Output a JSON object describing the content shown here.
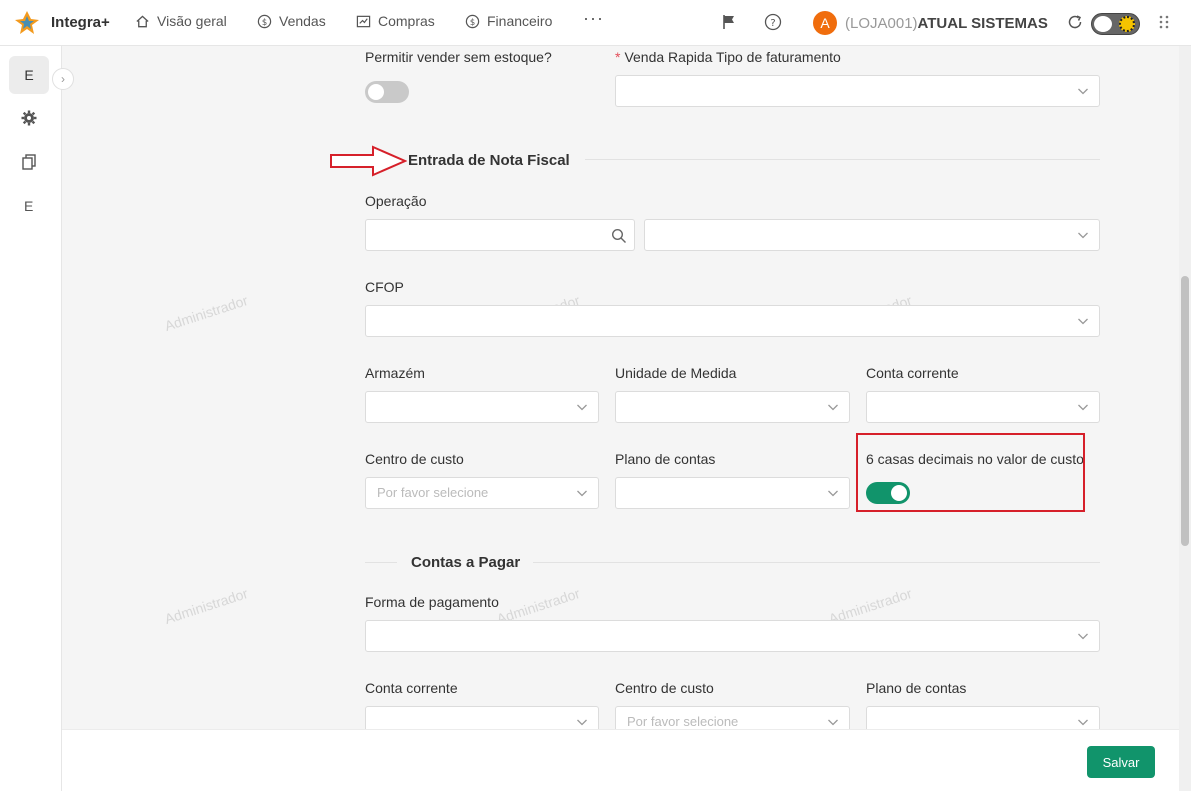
{
  "app": {
    "brand": "Integra+"
  },
  "nav": [
    {
      "label": "Visão geral",
      "icon": "home-icon"
    },
    {
      "label": "Vendas",
      "icon": "dollar-icon"
    },
    {
      "label": "Compras",
      "icon": "chart-icon"
    },
    {
      "label": "Financeiro",
      "icon": "dollar-icon"
    }
  ],
  "nav_more": "···",
  "user": {
    "avatar_letter": "A",
    "store_code": "(LOJA001)",
    "store_name": "ATUAL SISTEMAS"
  },
  "sidebar": {
    "item1": "E",
    "item2": "E"
  },
  "watermark": "Administrador",
  "fields": {
    "sell_without_stock": {
      "label": "Permitir vender sem estoque?",
      "enabled": false
    },
    "quick_sale_billing": {
      "label": "Venda Rapida Tipo de faturamento",
      "required": true,
      "value": ""
    }
  },
  "section_invoice": {
    "title": "Entrada de Nota Fiscal",
    "operation": {
      "label": "Operação",
      "value": ""
    },
    "cfop": {
      "label": "CFOP",
      "value": ""
    },
    "warehouse": {
      "label": "Armazém",
      "value": ""
    },
    "unit": {
      "label": "Unidade de Medida",
      "value": ""
    },
    "account": {
      "label": "Conta corrente",
      "value": ""
    },
    "cost_center": {
      "label": "Centro de custo",
      "placeholder": "Por favor selecione"
    },
    "chart_of_accounts": {
      "label": "Plano de contas",
      "value": ""
    },
    "six_decimals": {
      "label": "6 casas decimais no valor de custo",
      "enabled": true
    }
  },
  "section_payables": {
    "title": "Contas a Pagar",
    "payment_method": {
      "label": "Forma de pagamento",
      "value": ""
    },
    "account": {
      "label": "Conta corrente",
      "value": ""
    },
    "cost_center": {
      "label": "Centro de custo",
      "placeholder": "Por favor selecione"
    },
    "chart_of_accounts": {
      "label": "Plano de contas",
      "value": ""
    }
  },
  "footer": {
    "save_label": "Salvar"
  },
  "colors": {
    "accent": "#11946b",
    "highlight": "#d6202a",
    "avatar": "#f06d0d"
  }
}
